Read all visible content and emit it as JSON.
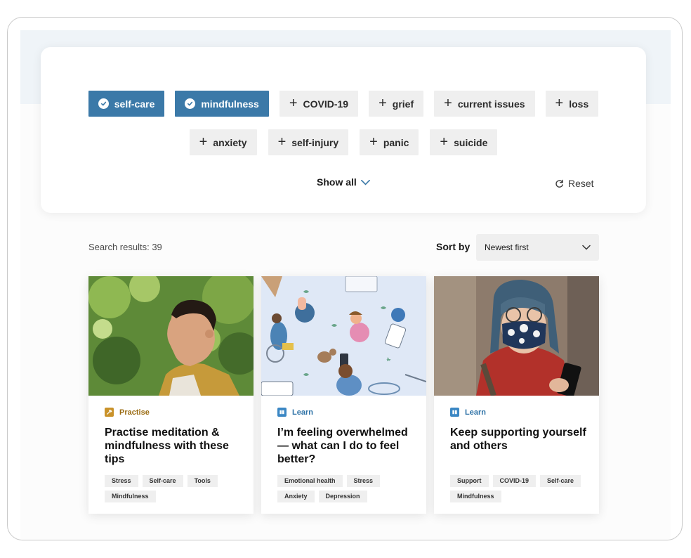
{
  "filters": {
    "row1": [
      {
        "label": "self-care",
        "selected": true
      },
      {
        "label": "mindfulness",
        "selected": true
      },
      {
        "label": "COVID-19",
        "selected": false
      },
      {
        "label": "grief",
        "selected": false
      },
      {
        "label": "current issues",
        "selected": false
      },
      {
        "label": "loss",
        "selected": false
      }
    ],
    "row2": [
      {
        "label": "anxiety",
        "selected": false
      },
      {
        "label": "self-injury",
        "selected": false
      },
      {
        "label": "panic",
        "selected": false
      },
      {
        "label": "suicide",
        "selected": false
      }
    ],
    "show_all_label": "Show all",
    "reset_label": "Reset"
  },
  "results": {
    "count_text": "Search results: 39",
    "sort_label": "Sort by",
    "sort_value": "Newest first"
  },
  "cards": [
    {
      "type": "Practise",
      "title": "Practise meditation & mindfulness with these tips",
      "tags": [
        "Stress",
        "Self-care",
        "Tools",
        "Mindfulness"
      ],
      "image": "young-man-outdoors-photo"
    },
    {
      "type": "Learn",
      "title": "I’m feeling overwhelmed — what can I do to feel better?",
      "tags": [
        "Emotional health",
        "Stress",
        "Anxiety",
        "Depression"
      ],
      "image": "people-illustration"
    },
    {
      "type": "Learn",
      "title": "Keep supporting yourself and others",
      "tags": [
        "Support",
        "COVID-19",
        "Self-care",
        "Mindfulness"
      ],
      "image": "woman-with-mask-photo"
    }
  ],
  "colors": {
    "selected_chip": "#3b79a8",
    "chip": "#efefef",
    "practise": "#9a6b11",
    "learn": "#2f73a7"
  }
}
